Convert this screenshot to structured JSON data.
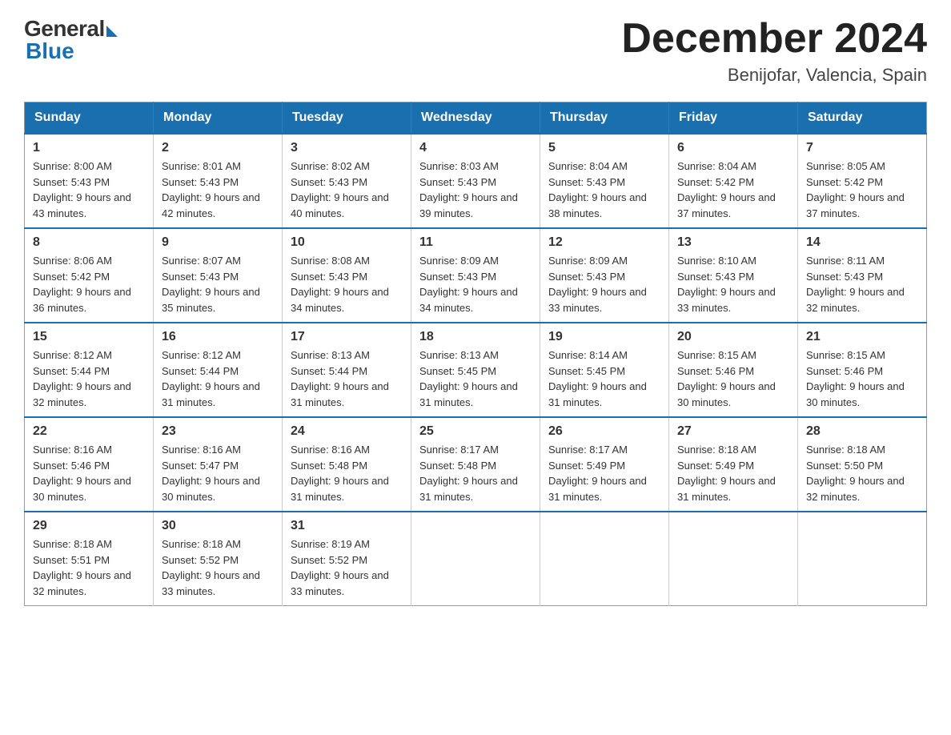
{
  "logo": {
    "general": "General",
    "blue": "Blue"
  },
  "title": {
    "month_year": "December 2024",
    "location": "Benijofar, Valencia, Spain"
  },
  "headers": [
    "Sunday",
    "Monday",
    "Tuesday",
    "Wednesday",
    "Thursday",
    "Friday",
    "Saturday"
  ],
  "weeks": [
    [
      {
        "day": "1",
        "sunrise": "8:00 AM",
        "sunset": "5:43 PM",
        "daylight": "9 hours and 43 minutes."
      },
      {
        "day": "2",
        "sunrise": "8:01 AM",
        "sunset": "5:43 PM",
        "daylight": "9 hours and 42 minutes."
      },
      {
        "day": "3",
        "sunrise": "8:02 AM",
        "sunset": "5:43 PM",
        "daylight": "9 hours and 40 minutes."
      },
      {
        "day": "4",
        "sunrise": "8:03 AM",
        "sunset": "5:43 PM",
        "daylight": "9 hours and 39 minutes."
      },
      {
        "day": "5",
        "sunrise": "8:04 AM",
        "sunset": "5:43 PM",
        "daylight": "9 hours and 38 minutes."
      },
      {
        "day": "6",
        "sunrise": "8:04 AM",
        "sunset": "5:42 PM",
        "daylight": "9 hours and 37 minutes."
      },
      {
        "day": "7",
        "sunrise": "8:05 AM",
        "sunset": "5:42 PM",
        "daylight": "9 hours and 37 minutes."
      }
    ],
    [
      {
        "day": "8",
        "sunrise": "8:06 AM",
        "sunset": "5:42 PM",
        "daylight": "9 hours and 36 minutes."
      },
      {
        "day": "9",
        "sunrise": "8:07 AM",
        "sunset": "5:43 PM",
        "daylight": "9 hours and 35 minutes."
      },
      {
        "day": "10",
        "sunrise": "8:08 AM",
        "sunset": "5:43 PM",
        "daylight": "9 hours and 34 minutes."
      },
      {
        "day": "11",
        "sunrise": "8:09 AM",
        "sunset": "5:43 PM",
        "daylight": "9 hours and 34 minutes."
      },
      {
        "day": "12",
        "sunrise": "8:09 AM",
        "sunset": "5:43 PM",
        "daylight": "9 hours and 33 minutes."
      },
      {
        "day": "13",
        "sunrise": "8:10 AM",
        "sunset": "5:43 PM",
        "daylight": "9 hours and 33 minutes."
      },
      {
        "day": "14",
        "sunrise": "8:11 AM",
        "sunset": "5:43 PM",
        "daylight": "9 hours and 32 minutes."
      }
    ],
    [
      {
        "day": "15",
        "sunrise": "8:12 AM",
        "sunset": "5:44 PM",
        "daylight": "9 hours and 32 minutes."
      },
      {
        "day": "16",
        "sunrise": "8:12 AM",
        "sunset": "5:44 PM",
        "daylight": "9 hours and 31 minutes."
      },
      {
        "day": "17",
        "sunrise": "8:13 AM",
        "sunset": "5:44 PM",
        "daylight": "9 hours and 31 minutes."
      },
      {
        "day": "18",
        "sunrise": "8:13 AM",
        "sunset": "5:45 PM",
        "daylight": "9 hours and 31 minutes."
      },
      {
        "day": "19",
        "sunrise": "8:14 AM",
        "sunset": "5:45 PM",
        "daylight": "9 hours and 31 minutes."
      },
      {
        "day": "20",
        "sunrise": "8:15 AM",
        "sunset": "5:46 PM",
        "daylight": "9 hours and 30 minutes."
      },
      {
        "day": "21",
        "sunrise": "8:15 AM",
        "sunset": "5:46 PM",
        "daylight": "9 hours and 30 minutes."
      }
    ],
    [
      {
        "day": "22",
        "sunrise": "8:16 AM",
        "sunset": "5:46 PM",
        "daylight": "9 hours and 30 minutes."
      },
      {
        "day": "23",
        "sunrise": "8:16 AM",
        "sunset": "5:47 PM",
        "daylight": "9 hours and 30 minutes."
      },
      {
        "day": "24",
        "sunrise": "8:16 AM",
        "sunset": "5:48 PM",
        "daylight": "9 hours and 31 minutes."
      },
      {
        "day": "25",
        "sunrise": "8:17 AM",
        "sunset": "5:48 PM",
        "daylight": "9 hours and 31 minutes."
      },
      {
        "day": "26",
        "sunrise": "8:17 AM",
        "sunset": "5:49 PM",
        "daylight": "9 hours and 31 minutes."
      },
      {
        "day": "27",
        "sunrise": "8:18 AM",
        "sunset": "5:49 PM",
        "daylight": "9 hours and 31 minutes."
      },
      {
        "day": "28",
        "sunrise": "8:18 AM",
        "sunset": "5:50 PM",
        "daylight": "9 hours and 32 minutes."
      }
    ],
    [
      {
        "day": "29",
        "sunrise": "8:18 AM",
        "sunset": "5:51 PM",
        "daylight": "9 hours and 32 minutes."
      },
      {
        "day": "30",
        "sunrise": "8:18 AM",
        "sunset": "5:52 PM",
        "daylight": "9 hours and 33 minutes."
      },
      {
        "day": "31",
        "sunrise": "8:19 AM",
        "sunset": "5:52 PM",
        "daylight": "9 hours and 33 minutes."
      },
      null,
      null,
      null,
      null
    ]
  ]
}
